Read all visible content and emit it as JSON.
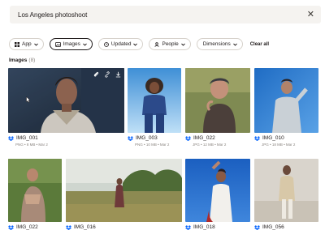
{
  "search": {
    "query": "Los Angeles photoshoot"
  },
  "filters": [
    {
      "label": "App",
      "icon": "grid-icon"
    },
    {
      "label": "Images",
      "icon": "image-icon",
      "active": true
    },
    {
      "label": "Updated",
      "icon": "clock-icon"
    },
    {
      "label": "People",
      "icon": "person-icon"
    },
    {
      "label": "Dimensions",
      "icon": ""
    }
  ],
  "clear_all": "Clear all",
  "section": {
    "title": "Images",
    "count": "(8)"
  },
  "images": [
    {
      "name": "IMG_001",
      "details": "PNG • 8 MB • Mar 2"
    },
    {
      "name": "IMG_003",
      "details": "PNG • 10 MB • Mar 2"
    },
    {
      "name": "IMG_022",
      "details": "JPG • 12 MB • Mar 2"
    },
    {
      "name": "IMG_010",
      "details": "JPG • 18 MB • Mar 2"
    },
    {
      "name": "IMG_022",
      "details": ""
    },
    {
      "name": "IMG_016",
      "details": ""
    },
    {
      "name": "IMG_018",
      "details": ""
    },
    {
      "name": "IMG_056",
      "details": ""
    }
  ],
  "colors": {
    "accent": "#0061fe",
    "text": "#1e1919",
    "muted": "#8a8580",
    "chip_border": "#d6d1ca"
  }
}
